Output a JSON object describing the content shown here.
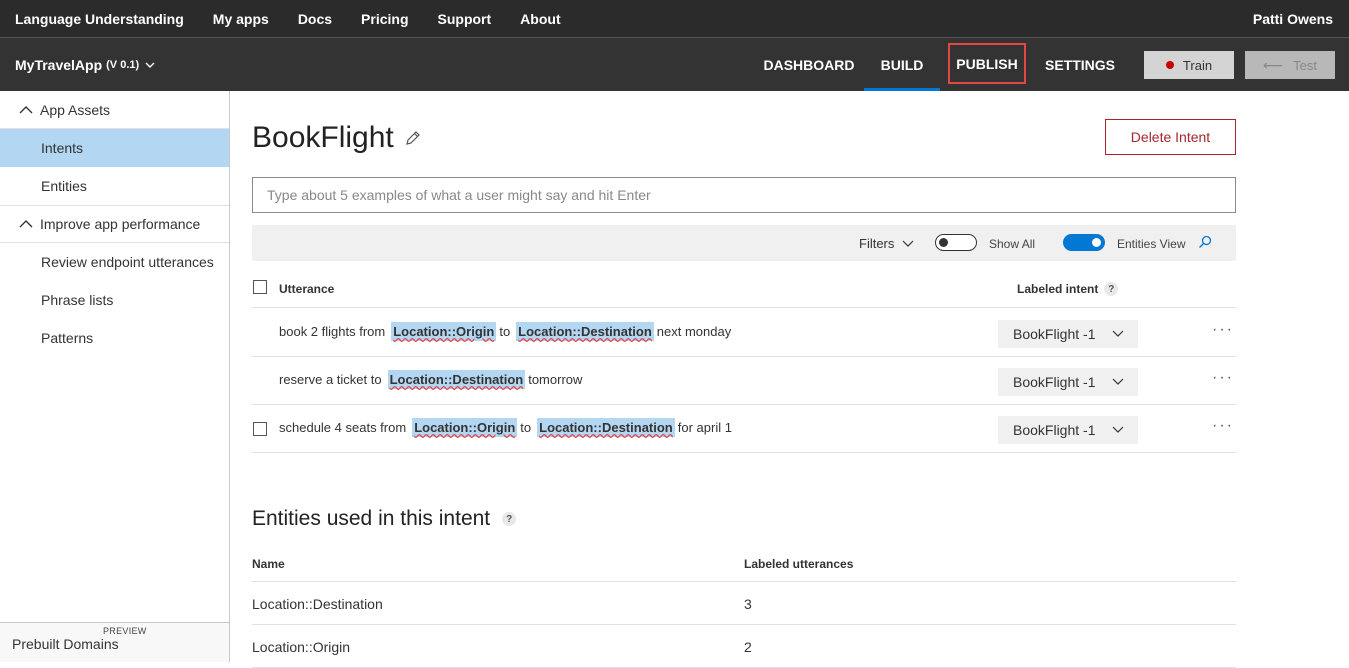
{
  "topnav": {
    "brand": "Language Understanding",
    "items": [
      "My apps",
      "Docs",
      "Pricing",
      "Support",
      "About"
    ],
    "user": "Patti Owens"
  },
  "appbar": {
    "app_name": "MyTravelApp",
    "version": "(V 0.1)",
    "tabs": {
      "dashboard": "DASHBOARD",
      "build": "BUILD",
      "publish": "PUBLISH",
      "settings": "SETTINGS"
    },
    "train_label": "Train",
    "test_label": "Test",
    "accent_color": "#0078d4",
    "highlight_color": "#e2483d"
  },
  "sidebar": {
    "group1": "App Assets",
    "intents": "Intents",
    "entities": "Entities",
    "group2": "Improve app performance",
    "review": "Review endpoint utterances",
    "phrase_lists": "Phrase lists",
    "patterns": "Patterns",
    "prebuilt_badge": "PREVIEW",
    "prebuilt": "Prebuilt Domains"
  },
  "main": {
    "title": "BookFlight",
    "delete_label": "Delete Intent",
    "input_placeholder": "Type about 5 examples of what a user might say and hit Enter",
    "filters_label": "Filters",
    "show_all_label": "Show All",
    "entities_view_label": "Entities View",
    "col_utterance": "Utterance",
    "col_labeled_intent": "Labeled intent",
    "qmark": "?",
    "rows": [
      {
        "p1": "book 2 flights from",
        "e1": "Location::Origin",
        "p2": "to",
        "e2": "Location::Destination",
        "p3": "next monday",
        "intent": "BookFlight -1"
      },
      {
        "p1": "reserve a ticket to",
        "e1": "Location::Destination",
        "p2": "tomorrow",
        "intent": "BookFlight -1"
      },
      {
        "p1": "schedule 4 seats from",
        "e1": "Location::Origin",
        "p2": "to",
        "e2": "Location::Destination",
        "p3": "for april 1",
        "intent": "BookFlight -1"
      }
    ],
    "more": "···",
    "entities_title": "Entities used in this intent",
    "ent_col_name": "Name",
    "ent_col_count": "Labeled utterances",
    "entities": [
      {
        "name": "Location::Destination",
        "count": "3"
      },
      {
        "name": "Location::Origin",
        "count": "2"
      }
    ]
  }
}
